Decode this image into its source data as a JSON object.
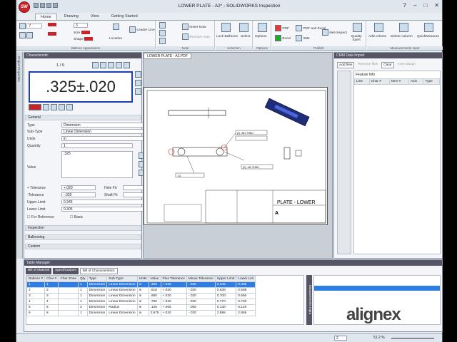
{
  "app": {
    "title": "LOWER PLATE - A2* - SOLIDWORKS Inspection",
    "logo_text": "SW"
  },
  "tabs": [
    "Home",
    "Drawing",
    "View",
    "Getting Started"
  ],
  "ribbon": {
    "balloon_appearance": {
      "label": "Balloon Appearance",
      "size_value": "7",
      "fill_value": "3",
      "size_label": "Size",
      "shape_label": "Shape",
      "location_label": "Location",
      "leader_label": "Leader Line"
    },
    "note": {
      "label": "Note",
      "insert_note": "Insert Note",
      "remove_note": "Remove note"
    },
    "selection": {
      "label": "Selection",
      "lock_balloons": "Lock Balloons",
      "select": "Select"
    },
    "options": {
      "label": "Options",
      "btn": "Options"
    },
    "publish": {
      "label": "Publish",
      "pdf": "PDF",
      "pdf_excel": "PDF and Excel",
      "excel": "Excel",
      "xml": "XML",
      "net_inspect": "Net-Inspect",
      "quality_xpert": "Quality Xpert"
    },
    "measurements": {
      "label": "Measurements Input",
      "add_column": "Add column",
      "delete_column": "Delete column",
      "quickmeasure": "QuickMeasure"
    }
  },
  "left_strip": "Project Properties",
  "characteristic": {
    "header": "Characteristic",
    "counter": "1 / 9",
    "display_value": ".325±.020",
    "general": "General",
    "type_label": "Type",
    "type_value": "Dimension",
    "subtype_label": "Sub-Type",
    "subtype_value": "Linear Dimension",
    "units_label": "Units",
    "units_value": "in",
    "quantity_label": "Quantity",
    "quantity_value": "1",
    "value_label": "Value",
    "value_value": ".325",
    "plus_tol_label": "+ Tolerance",
    "plus_tol_value": "+.020",
    "minus_tol_label": "-Tolerance",
    "minus_tol_value": "-.020",
    "hole_fit_label": "Hole Fit",
    "shaft_fit_label": "Shaft Fit",
    "upper_label": "Upper Limit",
    "upper_value": "0.345",
    "lower_label": "Lower Limit",
    "lower_value": "0.305",
    "for_ref": "For Reference",
    "basic": "Basic",
    "sections": [
      "Inspection",
      "Ballooning",
      "Custom"
    ]
  },
  "document_tab": "LOWER PLATE - A2.PDF",
  "drawing": {
    "title": "PLATE - LOWER",
    "size": "A",
    "dims": [
      "(2) .281 THRU",
      "(2) .140 THRU",
      ".375",
      ".154",
      ".14"
    ]
  },
  "cmm": {
    "header": "CMM Data Import",
    "add_files": "Add files",
    "remove_files": "Remove files",
    "clear": "Clear",
    "auto_assign": "Auto-assign",
    "feature_info": "Feature Info",
    "columns": [
      "Line",
      "Char #",
      "Item #",
      "Axis",
      "Type"
    ]
  },
  "table_manager": {
    "header": "Table Manager",
    "tabs": [
      "Bill of Material",
      "Specifications",
      "Bill of Characteristics"
    ],
    "columns": [
      "Balloon #",
      "Char #",
      "Char Zone",
      "Qty",
      "Type",
      "Sub-Type",
      "Units",
      "Value",
      "Plus Tolerance",
      "Minus Tolerance",
      "Upper Limit",
      "Lower Lim"
    ],
    "rows": [
      [
        "1",
        "1",
        "",
        "1",
        "Dimension",
        "Linear Dimension",
        "in",
        ".325",
        "+.020",
        "-.020",
        "0.345",
        "0.305"
      ],
      [
        "2",
        "2",
        "",
        "1",
        "Dimension",
        "Linear Dimension",
        "in",
        ".618",
        "+.020",
        "-.020",
        "0.638",
        "0.598"
      ],
      [
        "3",
        "3",
        "",
        "1",
        "Dimension",
        "Linear Dimension",
        "in",
        ".680",
        "+.020",
        "-.020",
        "0.700",
        "0.660"
      ],
      [
        "4",
        "4",
        "",
        "1",
        "Dimension",
        "Linear Dimension",
        "in",
        ".750",
        "+.020",
        "-.020",
        "0.770",
        "0.730"
      ],
      [
        "5",
        "5",
        "",
        "2",
        "Dimension",
        "Radius",
        "in",
        ".125",
        "+.005",
        "-.005",
        "0.130",
        "0.120"
      ],
      [
        "6",
        "6",
        "",
        "1",
        "Dimension",
        "Linear Dimension",
        "in",
        "2.875",
        "+.020",
        "-.020",
        "2.895",
        "2.855"
      ]
    ],
    "side_label": "Measurements Input"
  },
  "status": {
    "page": "2",
    "zoom": "51.2 %"
  },
  "watermark": "alignex"
}
